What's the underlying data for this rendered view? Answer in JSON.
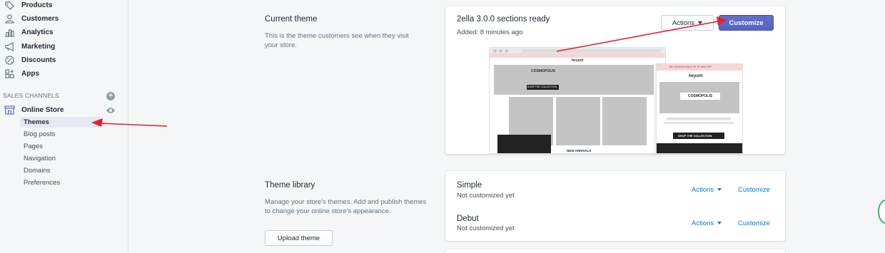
{
  "sidebar": {
    "items": [
      {
        "label": "Products",
        "icon": "tag-icon"
      },
      {
        "label": "Customers",
        "icon": "person-icon"
      },
      {
        "label": "Analytics",
        "icon": "bar-chart-icon"
      },
      {
        "label": "Marketing",
        "icon": "megaphone-icon"
      },
      {
        "label": "Discounts",
        "icon": "discount-icon"
      },
      {
        "label": "Apps",
        "icon": "apps-icon"
      }
    ],
    "sales_channels_label": "SALES CHANNELS",
    "online_store_label": "Online Store",
    "sub_items": [
      "Themes",
      "Blog posts",
      "Pages",
      "Navigation",
      "Domains",
      "Preferences"
    ]
  },
  "current_theme": {
    "title": "Current theme",
    "description": "This is the theme customers see when they visit your store.",
    "theme_name": "2ella 3.0.0 sections ready",
    "added": "Added: 8 minutes ago",
    "actions_label": "Actions",
    "customize_label": "Customize",
    "preview": {
      "desktop_logo": "heyunt",
      "desktop_hero": "COSMOPOLIS",
      "desktop_cta": "SHOP THE COLLECTION",
      "desktop_new": "NEW ARRIVALS",
      "mobile_banner": "BIG SEASON SALE UP TO 50% OFF",
      "mobile_logo": "heyunt",
      "mobile_hero": "COSMOPOLIS",
      "mobile_cta": "SHOP THE COLLECTION"
    }
  },
  "theme_library": {
    "title": "Theme library",
    "description": "Manage your store's themes. Add and publish themes to change your online store's appearance.",
    "upload_label": "Upload theme",
    "themes": [
      {
        "name": "Simple",
        "status": "Not customized yet",
        "actions_label": "Actions",
        "customize_label": "Customize"
      },
      {
        "name": "Debut",
        "status": "Not customized yet",
        "actions_label": "Actions",
        "customize_label": "Customize"
      }
    ]
  },
  "colors": {
    "primary": "#5c6ac4",
    "link": "#007ace",
    "annotation_arrow": "#e8202a"
  }
}
